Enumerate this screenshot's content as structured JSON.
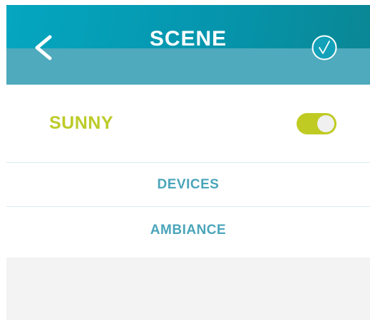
{
  "header": {
    "title": "SCENE",
    "back_icon": "chevron-left-icon",
    "confirm_icon": "check-circle-icon",
    "colors": {
      "gradient_start": "#05a6c0",
      "gradient_end": "#0a8795",
      "band": "#4eaabc",
      "text": "#ffffff"
    }
  },
  "scene": {
    "name": "SUNNY",
    "enabled": true,
    "colors": {
      "name": "#bccb29",
      "toggle_on": "#bfcb22",
      "knob": "#f0f0f0"
    }
  },
  "menu": {
    "items": [
      {
        "label": "DEVICES"
      },
      {
        "label": "AMBIANCE"
      }
    ],
    "color": "#4aa5ba",
    "divider_color": "#d7ecef"
  },
  "footer": {
    "background": "#f3f3f3"
  }
}
